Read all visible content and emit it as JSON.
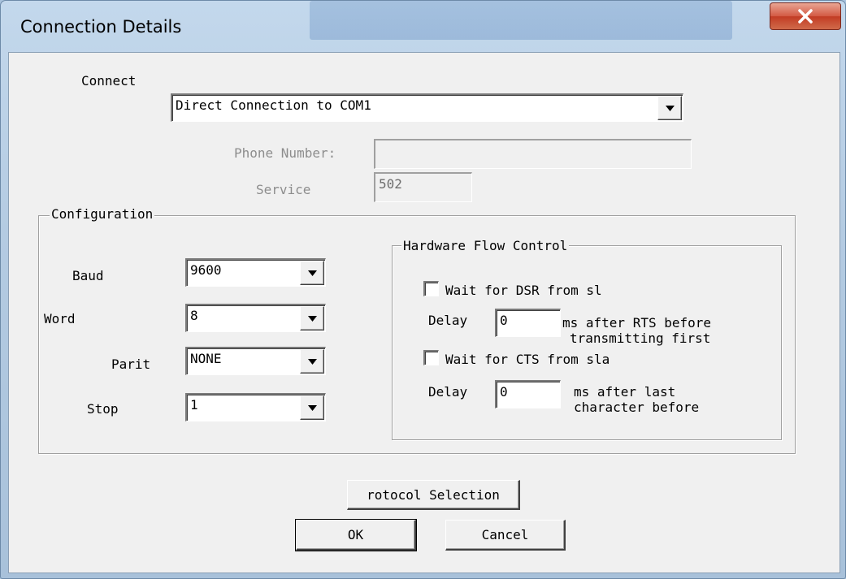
{
  "window": {
    "title": "Connection Details"
  },
  "connect": {
    "label": "Connect",
    "value": "Direct Connection to COM1",
    "phone_label": "Phone Number:",
    "phone_value": "",
    "service_label": "Service",
    "service_value": "502"
  },
  "configuration": {
    "title": "Configuration",
    "baud_label": "Baud",
    "baud_value": "9600",
    "word_label": "Word",
    "word_value": "8",
    "parity_label": "Parit",
    "parity_value": "NONE",
    "stop_label": "Stop",
    "stop_value": "1"
  },
  "flow": {
    "title": "Hardware Flow Control",
    "dsr_label": "Wait for DSR from sl",
    "dsr_checked": false,
    "delay1_label": "Delay",
    "delay1_value": "0",
    "delay1_note_line1": "ms after RTS before",
    "delay1_note_line2": "transmitting first",
    "cts_label": "Wait for CTS from sla",
    "cts_checked": false,
    "delay2_label": "Delay",
    "delay2_value": "0",
    "delay2_note_line1": "ms after last",
    "delay2_note_line2": "character before"
  },
  "buttons": {
    "protocol": "rotocol Selection",
    "ok": "OK",
    "cancel": "Cancel"
  },
  "icons": {
    "close": "close-icon",
    "dropdown": "chevron-down-icon"
  },
  "colors": {
    "close_button": "#c9452d",
    "dialog_bg": "#f0f0f0"
  }
}
